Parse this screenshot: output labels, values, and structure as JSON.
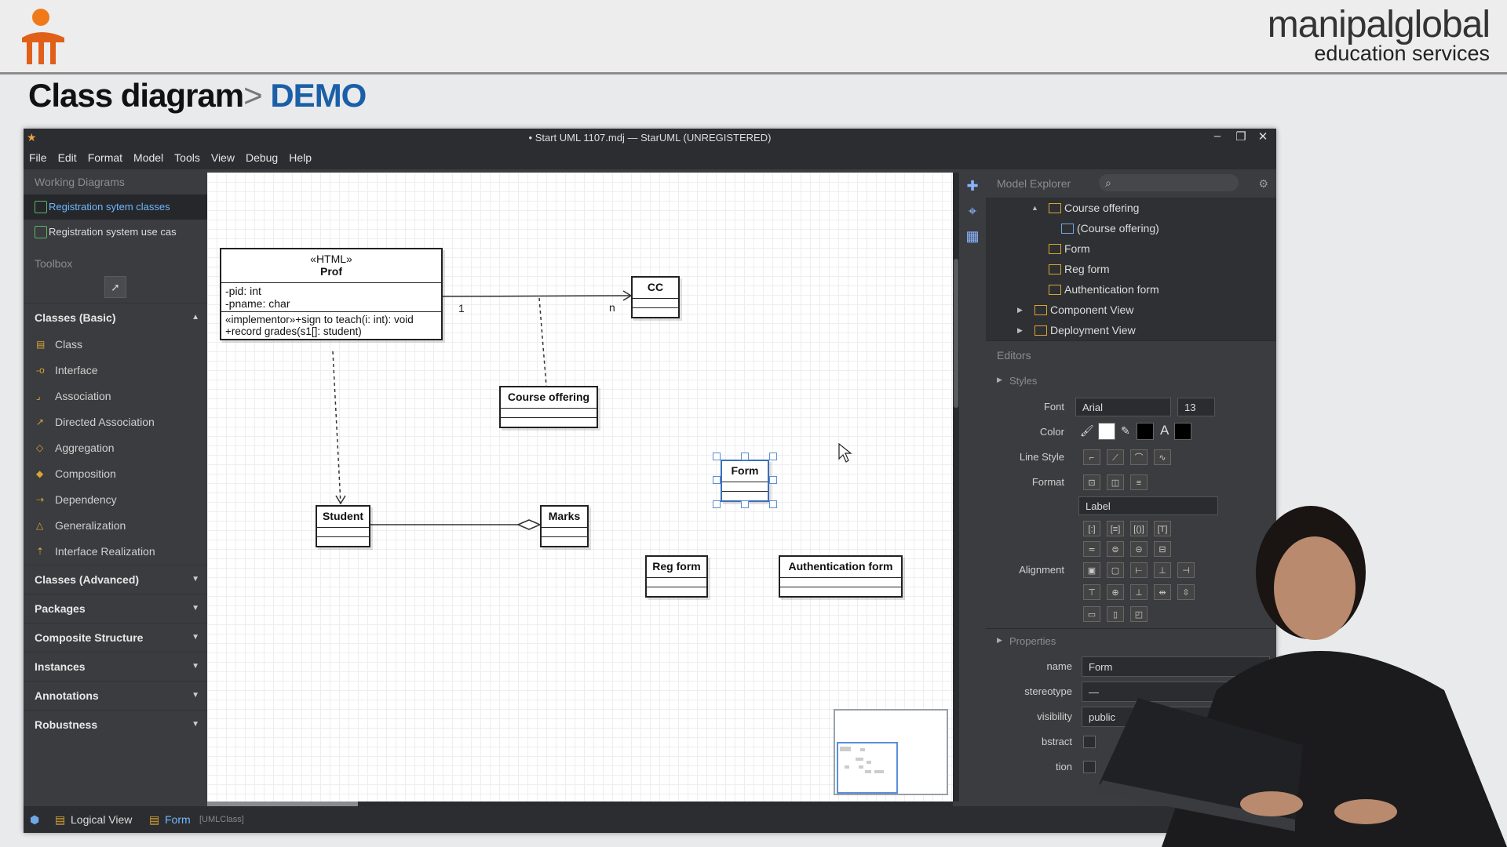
{
  "banner": {
    "brand_line1": "manipalglobal",
    "brand_line2": "education services"
  },
  "slide": {
    "title": "Class diagram",
    "separator": ">",
    "subtitle": "DEMO"
  },
  "window": {
    "title": "• Start UML 1107.mdj — StarUML (UNREGISTERED)",
    "minimize": "–",
    "restore": "❐",
    "close": "✕"
  },
  "menu": [
    "File",
    "Edit",
    "Format",
    "Model",
    "Tools",
    "View",
    "Debug",
    "Help"
  ],
  "left": {
    "working_diagrams_header": "Working Diagrams",
    "working_diagrams": [
      "Registration sytem classes",
      "Registration system use cas"
    ],
    "toolbox_header": "Toolbox",
    "category_basic": "Classes (Basic)",
    "tools": [
      "Class",
      "Interface",
      "Association",
      "Directed Association",
      "Aggregation",
      "Composition",
      "Dependency",
      "Generalization",
      "Interface Realization"
    ],
    "categories": [
      "Classes (Advanced)",
      "Packages",
      "Composite Structure",
      "Instances",
      "Annotations",
      "Robustness"
    ]
  },
  "diagram": {
    "prof": {
      "stereotype": "«HTML»",
      "name": "Prof",
      "attr1": "-pid: int",
      "attr2": "-pname: char",
      "op1": "«implementor»+sign to teach(i: int): void",
      "op2": "+record grades(s1[]: student)"
    },
    "cc": "CC",
    "course_offering": "Course offering",
    "form": "Form",
    "student": "Student",
    "marks": "Marks",
    "reg_form": "Reg form",
    "auth_form": "Authentication form",
    "mult_1": "1",
    "mult_n": "n"
  },
  "right": {
    "model_explorer": "Model Explorer",
    "tree": {
      "course_offering": "Course offering",
      "course_offering_diagram": "(Course offering)",
      "form": "Form",
      "reg_form": "Reg form",
      "auth_form": "Authentication form",
      "component_view": "Component View",
      "deployment_view": "Deployment View"
    },
    "editors": "Editors",
    "styles": "Styles",
    "font_label": "Font",
    "font_value": "Arial",
    "font_size": "13",
    "color_label": "Color",
    "line_style_label": "Line Style",
    "format_label": "Format",
    "format_value": "Label",
    "alignment_label": "Alignment",
    "properties": "Properties",
    "name_label": "name",
    "name_value": "Form",
    "stereotype_label": "stereotype",
    "stereotype_value": "—",
    "visibility_label": "visibility",
    "visibility_value": "public",
    "abstract_label": "bstract",
    "fifth_label": "tion"
  },
  "status": {
    "logical_view": "Logical View",
    "form": "Form",
    "form_type": "[UMLClass]"
  },
  "colors": {
    "accent": "#1a5fa8",
    "selection": "#6fb8ff",
    "panel": "#3b3c3f"
  }
}
